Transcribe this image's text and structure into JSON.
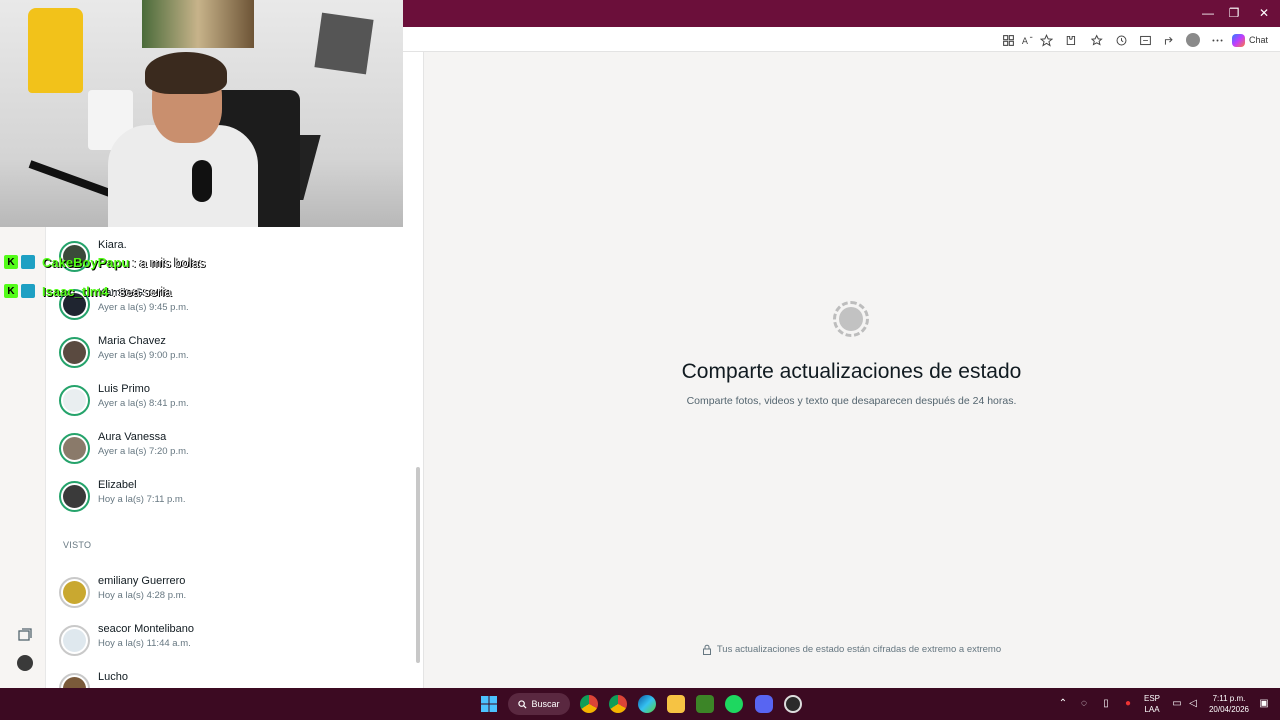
{
  "browser": {
    "chat_label": "Chat",
    "window_controls": [
      "—",
      "❐",
      "✕"
    ]
  },
  "stream_chat": [
    {
      "user": "CakeBoyPapu",
      "message": ": a mis bolas"
    },
    {
      "user": "Isaac_tlm4",
      "message": ": sea seria"
    }
  ],
  "status_list": {
    "recent": [
      {
        "name": "Kiara.",
        "time": "",
        "color": "#3b4a3a"
      },
      {
        "name": "Kamila G",
        "time": "Ayer a la(s) 9:45 p.m.",
        "color": "#1f2530"
      },
      {
        "name": "Maria Chavez",
        "time": "Ayer a la(s) 9:00 p.m.",
        "color": "#5a4a40"
      },
      {
        "name": "Luis Primo",
        "time": "Ayer a la(s) 8:41 p.m.",
        "color": "#e9eef0"
      },
      {
        "name": "Aura Vanessa",
        "time": "Ayer a la(s) 7:20 p.m.",
        "color": "#8a7a6a"
      },
      {
        "name": "Elizabel",
        "time": "Hoy a la(s) 7:11 p.m.",
        "color": "#3a3a3a"
      }
    ],
    "seen_label": "VISTO",
    "seen": [
      {
        "name": "emiliany Guerrero",
        "time": "Hoy a la(s) 4:28 p.m.",
        "color": "#c9a830"
      },
      {
        "name": "seacor Montelibano",
        "time": "Hoy a la(s) 11:44 a.m.",
        "color": "#dfe8ee"
      },
      {
        "name": "Lucho",
        "time": "",
        "color": "#7a5a3a"
      }
    ]
  },
  "main": {
    "title": "Comparte actualizaciones de estado",
    "subtitle": "Comparte fotos, videos y texto que desaparecen después de 24 horas.",
    "encryption_note": "Tus actualizaciones de estado están cifradas de extremo a extremo"
  },
  "taskbar": {
    "search_label": "Buscar",
    "lang_top": "ESP",
    "lang_bottom": "LAA",
    "time": "7:11 p.m.",
    "date": "20/04/2026"
  },
  "colors": {
    "accent": "#25a36b",
    "titlebar": "#6b0f3a",
    "taskbar": "#3c0a22"
  }
}
